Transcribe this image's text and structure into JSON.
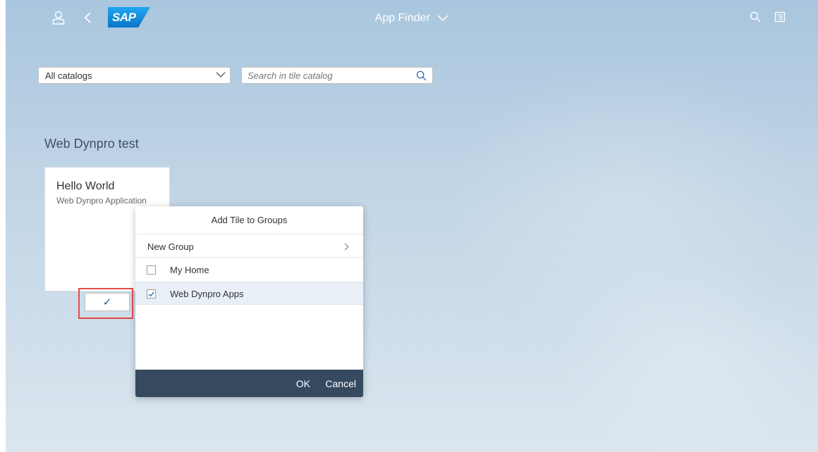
{
  "shell": {
    "title": "App Finder",
    "logo_text": "SAP",
    "icons": [
      "user-icon",
      "back-icon",
      "chevron-down-icon",
      "search-icon",
      "notifications-icon"
    ]
  },
  "filters": {
    "catalog_value": "All catalogs",
    "search_placeholder": "Search in tile catalog"
  },
  "catalog": {
    "name": "Web Dynpro test",
    "tiles": [
      {
        "title": "Hello World",
        "subtitle": "Web Dynpro Application"
      }
    ],
    "tile_action_symbol": "✓"
  },
  "popover": {
    "title": "Add Tile to Groups",
    "new_group_label": "New Group",
    "groups": [
      {
        "label": "My Home",
        "checked": false
      },
      {
        "label": "Web Dynpro Apps",
        "checked": true
      }
    ],
    "ok_label": "OK",
    "cancel_label": "Cancel"
  },
  "colors": {
    "shell_text": "#ffffff",
    "accent": "#0a6ed1",
    "popover_footer": "#354a5f",
    "highlight": "#e6494a"
  }
}
